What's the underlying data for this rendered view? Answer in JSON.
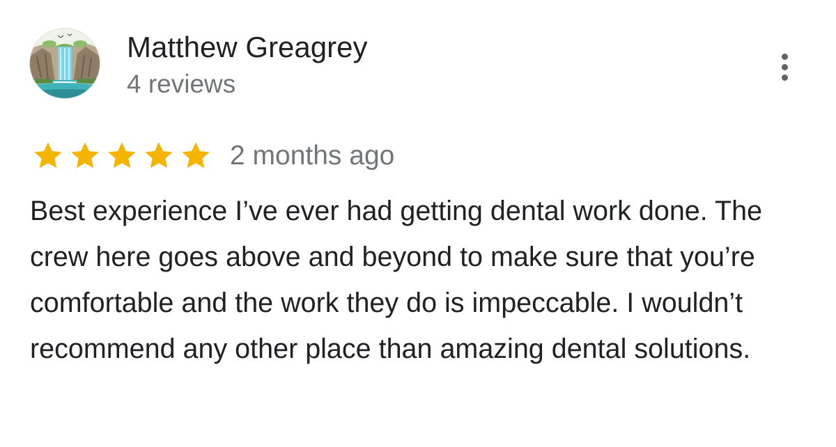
{
  "review": {
    "author": {
      "name": "Matthew Greagrey",
      "reviews_count": "4 reviews",
      "avatar_icon": "waterfall-landscape-avatar"
    },
    "rating": 5,
    "rating_max": 5,
    "time_ago": "2 months ago",
    "text": "Best experience I’ve ever had getting dental work done. The crew here goes above and beyond to make sure that you’re comfortable and the work they do is impeccable. I wouldn’t recommend any other place than amazing dental solutions."
  },
  "menu": {
    "icon": "more-vert-icon"
  },
  "colors": {
    "star": "#f4b400",
    "primary_text": "#202124",
    "secondary_text": "#70757a",
    "menu_icon": "#5f6368"
  }
}
